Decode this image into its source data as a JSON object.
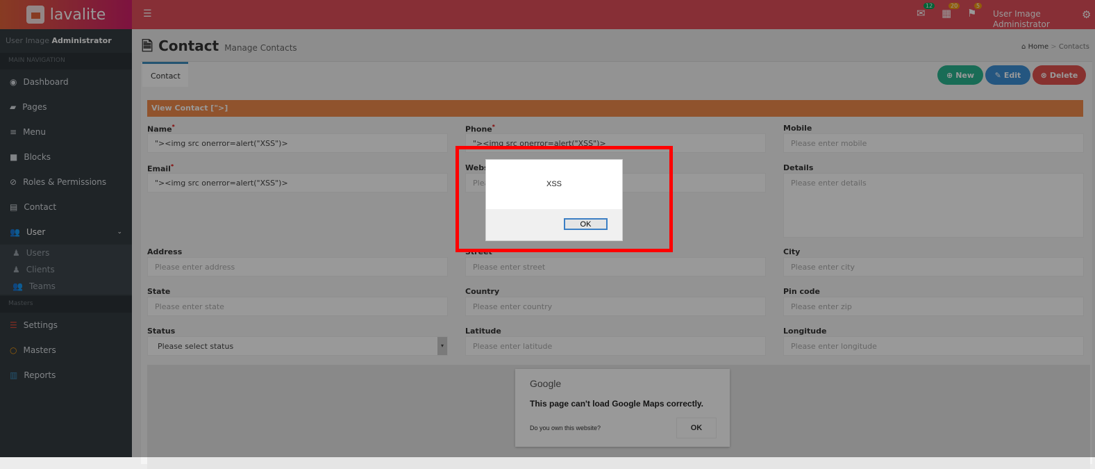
{
  "header": {
    "logo": "lavalite",
    "badges": [
      {
        "icon": "envelope-icon",
        "count": "12",
        "color": "#00a65a"
      },
      {
        "icon": "calendar-icon",
        "count": "20",
        "color": "#f39c12"
      },
      {
        "icon": "flag-icon",
        "count": "5",
        "color": "#f39c12"
      }
    ],
    "user_image_alt": "User Image",
    "user_name": "Administrator"
  },
  "sidebar": {
    "user_image_alt": "User Image",
    "user_name": "Administrator",
    "section_main": "MAIN NAVIGATION",
    "items": [
      {
        "label": "Dashboard",
        "icon": "dashboard-icon"
      },
      {
        "label": "Pages",
        "icon": "book-icon"
      },
      {
        "label": "Menu",
        "icon": "bars-icon"
      },
      {
        "label": "Blocks",
        "icon": "square-icon"
      },
      {
        "label": "Roles & Permissions",
        "icon": "check-circle-icon"
      },
      {
        "label": "Contact",
        "icon": "address-card-icon"
      },
      {
        "label": "User",
        "icon": "users-icon"
      }
    ],
    "user_sub": [
      "Users",
      "Clients",
      "Teams"
    ],
    "section_masters": "Masters",
    "masters": [
      {
        "label": "Settings",
        "icon": "sliders-icon",
        "color": "#dd4b39"
      },
      {
        "label": "Masters",
        "icon": "circle-icon",
        "color": "#f39c12"
      },
      {
        "label": "Reports",
        "icon": "bar-chart-icon",
        "color": "#3c8dbc"
      }
    ]
  },
  "page": {
    "title": "Contact",
    "subtitle": "Manage Contacts",
    "breadcrumb": [
      "Home",
      "Contacts"
    ],
    "tab": "Contact",
    "buttons": {
      "new": "New",
      "edit": "Edit",
      "delete": "Delete"
    },
    "view_title": "View Contact [\">]"
  },
  "form": {
    "name": {
      "label": "Name",
      "value": "\"><img src onerror=alert(\"XSS\")>"
    },
    "phone": {
      "label": "Phone",
      "value": "\"><img src onerror=alert(\"XSS\")>"
    },
    "mobile": {
      "label": "Mobile",
      "placeholder": "Please enter mobile"
    },
    "email": {
      "label": "Email",
      "value": "\"><img src onerror=alert(\"XSS\")>"
    },
    "website": {
      "label": "Website",
      "placeholder": "Please enter website"
    },
    "details": {
      "label": "Details",
      "placeholder": "Please enter details"
    },
    "address": {
      "label": "Address",
      "placeholder": "Please enter address"
    },
    "street": {
      "label": "Street",
      "placeholder": "Please enter street"
    },
    "city": {
      "label": "City",
      "placeholder": "Please enter city"
    },
    "state": {
      "label": "State",
      "placeholder": "Please enter state"
    },
    "country": {
      "label": "Country",
      "placeholder": "Please enter country"
    },
    "pincode": {
      "label": "Pin code",
      "placeholder": "Please enter zip"
    },
    "status": {
      "label": "Status",
      "selected": "Please select status"
    },
    "latitude": {
      "label": "Latitude",
      "placeholder": "Please enter latitude"
    },
    "longitude": {
      "label": "Longitude",
      "placeholder": "Please enter longitude"
    }
  },
  "map_error": {
    "brand": "Google",
    "message": "This page can't load Google Maps correctly.",
    "question": "Do you own this website?",
    "ok": "OK"
  },
  "alert": {
    "message": "XSS",
    "ok": "OK"
  }
}
